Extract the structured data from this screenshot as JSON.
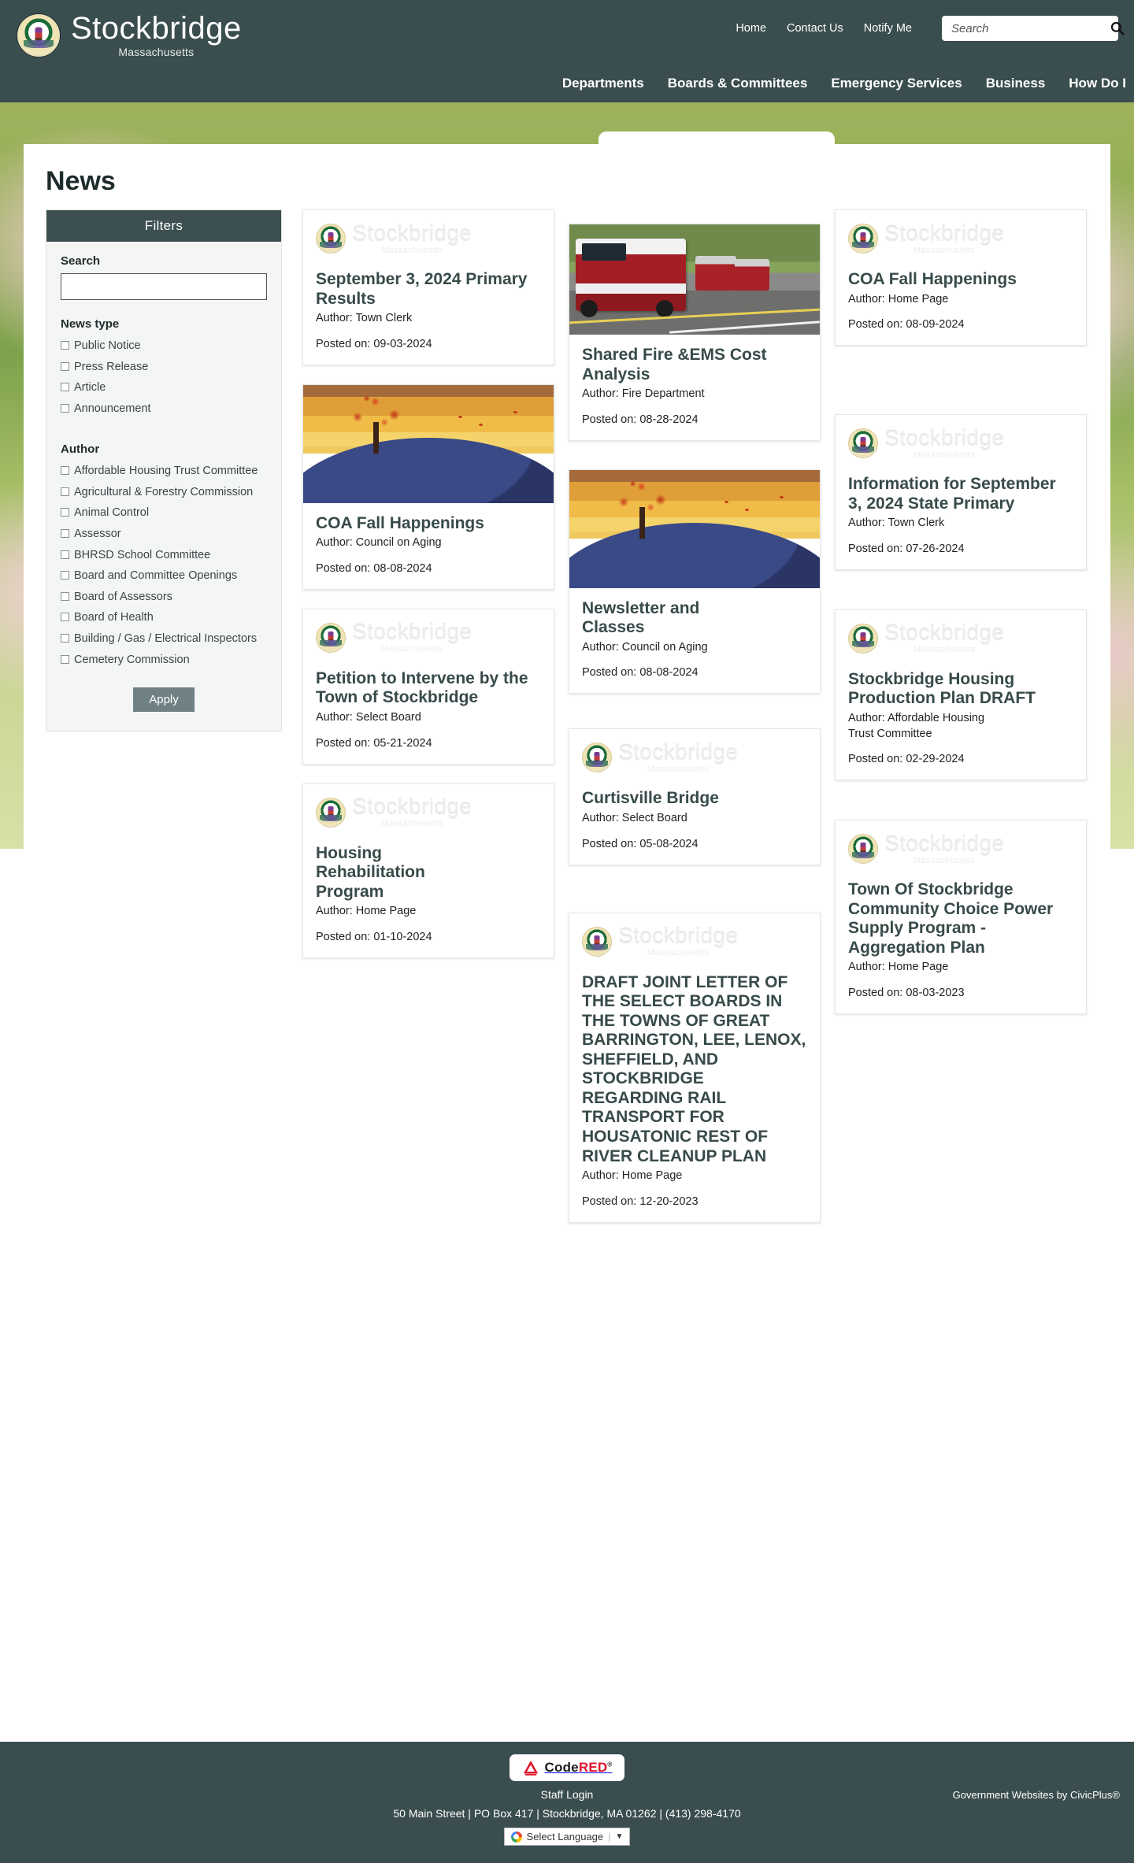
{
  "header": {
    "brand_title": "Stockbridge",
    "brand_subtitle": "Massachusetts",
    "seal_icon": "town-seal-icon",
    "top_links": [
      {
        "label": "Home"
      },
      {
        "label": "Contact Us"
      },
      {
        "label": "Notify Me"
      }
    ],
    "search": {
      "placeholder": "Search",
      "value": "",
      "icon": "search-icon"
    },
    "main_nav": [
      {
        "label": "Departments"
      },
      {
        "label": "Boards & Committees"
      },
      {
        "label": "Emergency Services"
      },
      {
        "label": "Business"
      },
      {
        "label": "How Do I"
      }
    ]
  },
  "page": {
    "title": "News"
  },
  "sidebar": {
    "filters_heading": "Filters",
    "search_label": "Search",
    "search_value": "",
    "news_type_label": "News type",
    "news_types": [
      {
        "label": "Public Notice",
        "checked": false
      },
      {
        "label": "Press Release",
        "checked": false
      },
      {
        "label": "Article",
        "checked": false
      },
      {
        "label": "Announcement",
        "checked": false
      }
    ],
    "author_label": "Author",
    "authors": [
      {
        "label": "Affordable Housing Trust Committee",
        "checked": false
      },
      {
        "label": "Agricultural & Forestry Commission",
        "checked": false
      },
      {
        "label": "Animal Control",
        "checked": false
      },
      {
        "label": "Assessor",
        "checked": false
      },
      {
        "label": "BHRSD School Committee",
        "checked": false
      },
      {
        "label": "Board and Committee Openings",
        "checked": false
      },
      {
        "label": "Board of Assessors",
        "checked": false
      },
      {
        "label": "Board of Health",
        "checked": false
      },
      {
        "label": "Building / Gas / Electrical Inspectors",
        "checked": false
      },
      {
        "label": "Cemetery Commission",
        "checked": false
      }
    ],
    "apply_label": "Apply"
  },
  "news": {
    "author_prefix": "Author: ",
    "posted_prefix": "Posted on: ",
    "columns": [
      [
        {
          "media": "logo",
          "title": "September 3, 2024 Primary Results",
          "author": "Author: Town Clerk",
          "posted": "Posted on: 09-03-2024"
        },
        {
          "media": "tree",
          "title": "COA Fall Happenings",
          "author": "Author: Council on Aging",
          "posted": "Posted on: 08-08-2024"
        },
        {
          "media": "logo",
          "title": "Petition to Intervene by the Town of Stockbridge",
          "author": "Author: Select Board",
          "posted": "Posted on: 05-21-2024"
        },
        {
          "media": "logo",
          "title": "Housing Rehabilitation Program",
          "author": "Author: Home Page",
          "posted": "Posted on: 01-10-2024"
        }
      ],
      [
        {
          "media": "fire",
          "title": "Shared Fire &EMS Cost Analysis",
          "author": "Author: Fire Department",
          "posted": "Posted on: 08-28-2024"
        },
        {
          "media": "tree",
          "title": "Newsletter and Classes",
          "author": "Author: Council on Aging",
          "posted": "Posted on: 08-08-2024"
        },
        {
          "media": "logo",
          "title": "Curtisville Bridge",
          "author": "Author: Select Board",
          "posted": "Posted on: 05-08-2024"
        },
        {
          "media": "logo",
          "title": "DRAFT JOINT LETTER OF THE SELECT BOARDS IN THE TOWNS OF GREAT BARRINGTON, LEE, LENOX, SHEFFIELD, AND STOCKBRIDGE REGARDING RAIL TRANSPORT FOR HOUSATONIC REST OF RIVER CLEANUP PLAN",
          "author": "Author: Home Page",
          "posted": "Posted on: 12-20-2023"
        }
      ],
      [
        {
          "media": "logo",
          "title": "COA Fall Happenings",
          "author": "Author: Home Page",
          "posted": "Posted on: 08-09-2024"
        },
        {
          "media": "logo",
          "title": "Information for September 3, 2024 State Primary",
          "author": "Author: Town Clerk",
          "posted": "Posted on: 07-26-2024"
        },
        {
          "media": "logo",
          "title": "Stockbridge Housing Production Plan DRAFT",
          "author": "Author: Affordable Housing Trust Committee",
          "posted": "Posted on: 02-29-2024"
        },
        {
          "media": "logo",
          "title": "Town Of Stockbridge Community Choice Power Supply Program - Aggregation Plan",
          "author": "Author: Home Page",
          "posted": "Posted on: 08-03-2023"
        }
      ]
    ],
    "card_watermark": {
      "main": "Stockbridge",
      "sub": "Massachusetts"
    }
  },
  "footer": {
    "codered": {
      "code": "Code",
      "red": "RED",
      "tm": "®",
      "icon": "codered-logo-icon"
    },
    "staff_login": "Staff Login",
    "address": "50 Main Street | PO Box 417 | Stockbridge, MA 01262 | (413) 298-4170",
    "language_select": {
      "label": "Select Language",
      "icon": "google-translate-icon",
      "caret": "▼"
    },
    "credit": "Government Websites by CivicPlus®"
  },
  "colors": {
    "header_bg": "#3a4d4f",
    "filters_bg": "#3c4f51",
    "apply_btn": "#6f8184",
    "card_title": "#384a4a",
    "codered_red": "#e0162b"
  }
}
